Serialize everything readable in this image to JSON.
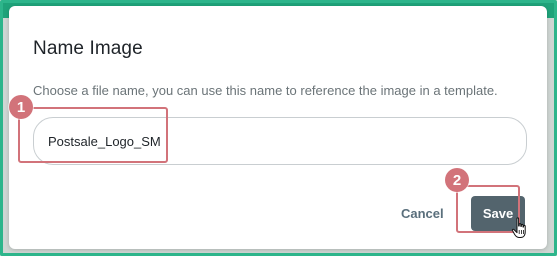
{
  "dialog": {
    "title": "Name Image",
    "description": "Choose a file name, you can use this name to reference the image in a template.",
    "name_input": {
      "value": "Postsale_Logo_SM"
    },
    "cancel_label": "Cancel",
    "save_label": "Save"
  },
  "annotations": {
    "step_1": "1",
    "step_2": "2",
    "highlight_color": "#d2737a"
  },
  "colors": {
    "frame_accent": "#2db58b",
    "save_button": "#53646d",
    "cancel_text": "#5a6f7c"
  },
  "icons": {
    "cursor": "hand-pointer-icon"
  }
}
